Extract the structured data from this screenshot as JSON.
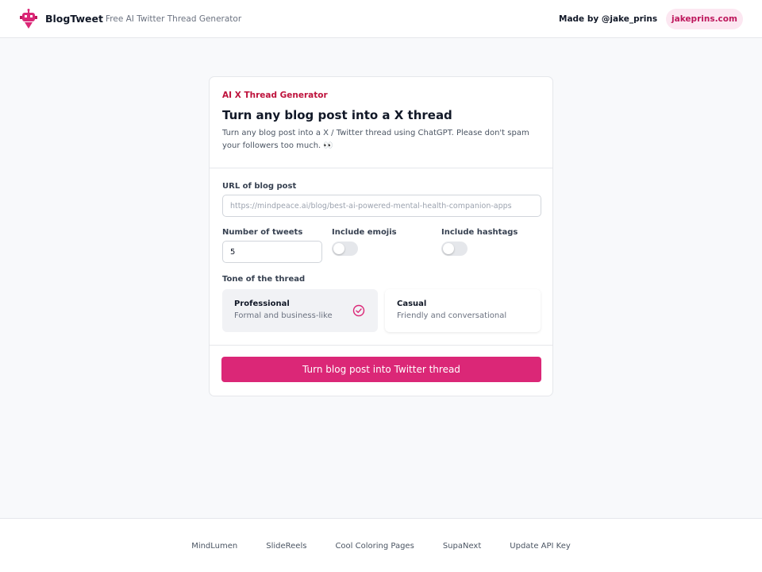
{
  "header": {
    "brand": "BlogTweet",
    "tagline": "Free AI Twitter Thread Generator",
    "made_by": "Made by @jake_prins",
    "site_button": "jakeprins.com",
    "logo_icon": "robot-icon"
  },
  "card": {
    "eyebrow": "AI X Thread Generator",
    "title": "Turn any blog post into a X thread",
    "description": "Turn any blog post into a X / Twitter thread using ChatGPT. Please don't spam your followers too much. 👀"
  },
  "form": {
    "url_label": "URL of blog post",
    "url_placeholder": "https://mindpeace.ai/blog/best-ai-powered-mental-health-companion-apps",
    "tweets_label": "Number of tweets",
    "tweets_value": "5",
    "emojis_label": "Include emojis",
    "emojis_on": false,
    "hashtags_label": "Include hashtags",
    "hashtags_on": false,
    "tone_label": "Tone of the thread",
    "tones": [
      {
        "title": "Professional",
        "subtitle": "Formal and business-like",
        "selected": true
      },
      {
        "title": "Casual",
        "subtitle": "Friendly and conversational",
        "selected": false
      }
    ],
    "submit_label": "Turn blog post into Twitter thread"
  },
  "footer": {
    "links": [
      "MindLumen",
      "SlideReels",
      "Cool Coloring Pages",
      "SupaNext",
      "Update API Key"
    ]
  },
  "colors": {
    "accent": "#db2777",
    "eyebrow": "#be123c",
    "background": "#f8f9fb"
  }
}
